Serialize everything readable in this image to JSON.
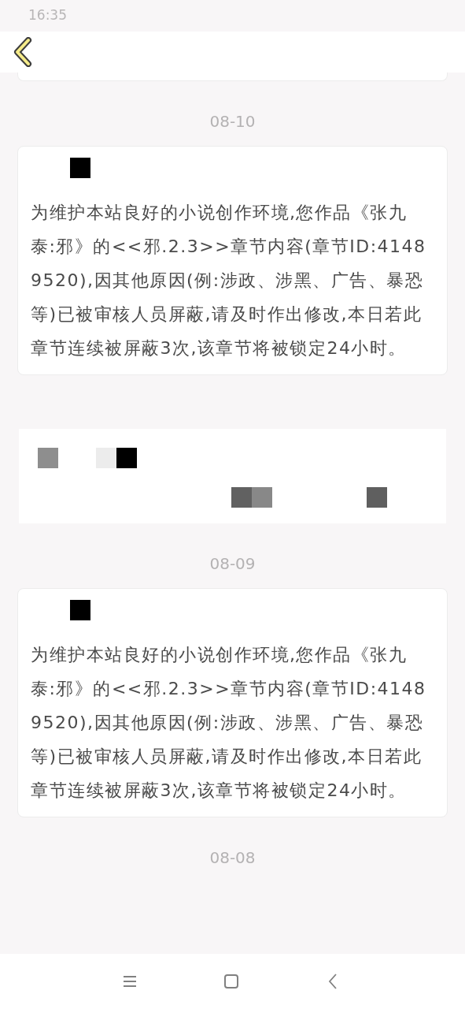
{
  "status_bar": {
    "time": "16:35"
  },
  "feed": [
    {
      "kind": "date",
      "text": "08-10"
    },
    {
      "kind": "notice",
      "text": "为维护本站良好的小说创作环境,您作品《张九泰:邪》的<<邪.2.3>>章节内容(章节ID:41489520),因其他原因(例:涉政、涉黑、广告、暴恐等)已被审核人员屏蔽,请及时作出修改,本日若此章节连续被屏蔽3次,该章节将被锁定24小时。"
    },
    {
      "kind": "redacted"
    },
    {
      "kind": "date",
      "text": "08-09"
    },
    {
      "kind": "notice",
      "text": "为维护本站良好的小说创作环境,您作品《张九泰:邪》的<<邪.2.3>>章节内容(章节ID:41489520),因其他原因(例:涉政、涉黑、广告、暴恐等)已被审核人员屏蔽,请及时作出修改,本日若此章节连续被屏蔽3次,该章节将被锁定24小时。"
    },
    {
      "kind": "date",
      "text": "08-08"
    }
  ]
}
